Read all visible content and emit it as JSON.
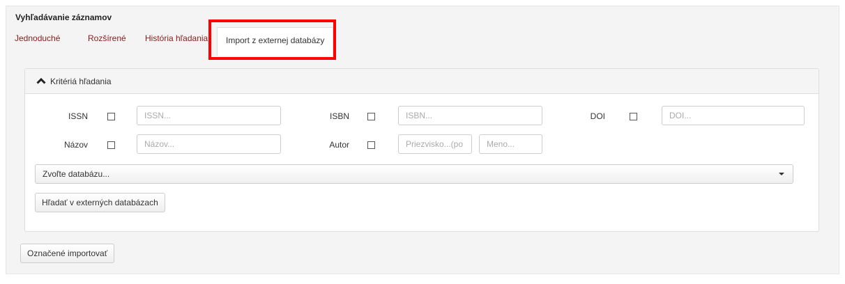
{
  "page_title": "Vyhľadávanie záznamov",
  "tabs": [
    {
      "label": "Jednoduché",
      "active": false
    },
    {
      "label": "Rozšírené",
      "active": false
    },
    {
      "label": "História hľadania",
      "active": false
    },
    {
      "label": "Import z externej databázy",
      "active": true
    }
  ],
  "criteria": {
    "title": "Kritériá hľadania",
    "toggle_icon": "chevron-up-icon",
    "fields": {
      "issn": {
        "label": "ISSN",
        "placeholder": "ISSN..."
      },
      "isbn": {
        "label": "ISBN",
        "placeholder": "ISBN..."
      },
      "doi": {
        "label": "DOI",
        "placeholder": "DOI..."
      },
      "nazov": {
        "label": "Názov",
        "placeholder": "Názov..."
      },
      "autor": {
        "label": "Autor",
        "placeholder_surname": "Priezvisko...(po",
        "placeholder_name": "Meno..."
      }
    },
    "database_select": "Zvoľte databázu...",
    "search_button": "Hľadať v externých databázach"
  },
  "import_button": "Označené importovať",
  "colors": {
    "tab_link": "#8b1a1a",
    "highlight": "#ff0000"
  }
}
